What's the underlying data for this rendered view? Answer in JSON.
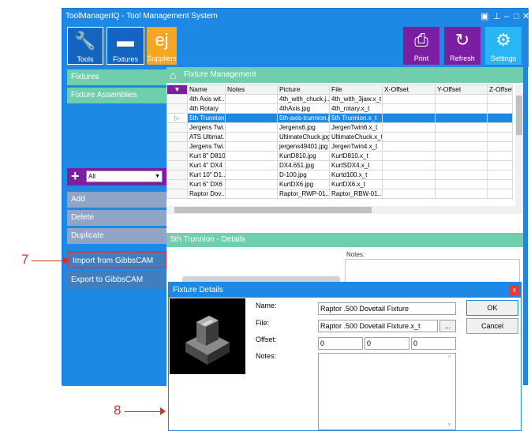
{
  "window": {
    "title": "ToolManagerIQ - Tool Management System"
  },
  "toolbar": {
    "tools_label": "Tools",
    "fixtures_label": "Fixtures",
    "suppliers_label": "Suppliers",
    "print_label": "Print",
    "refresh_label": "Refresh",
    "settings_label": "Settings"
  },
  "sidebar": {
    "fixtures": "Fixtures",
    "assemblies": "Fixture Assemblies",
    "filter_value": "All",
    "add": "Add",
    "delete": "Delete",
    "duplicate": "Duplicate",
    "import": "Import from GibbsCAM",
    "export": "Export to GibbsCAM"
  },
  "main": {
    "header": "Fixture Management",
    "details_header": "5th Trunnion - Details",
    "notes_label": "Notes:"
  },
  "grid": {
    "columns": [
      "Name",
      "Notes",
      "Picture",
      "File",
      "X-Offset",
      "Y-Offset",
      "Z-Offset"
    ],
    "rows": [
      [
        "4th Axis wit...",
        "",
        "4th_with_chuck.j...",
        "4th_with_3jaw.x_t",
        "",
        "",
        ""
      ],
      [
        "4th Rotary",
        "",
        "4thAxis.jpg",
        "4th_rotary.x_t",
        "",
        "",
        ""
      ],
      [
        "5th Trunnion",
        "",
        "5th-axis-trunnion.j...",
        "5th Trunnion.x_t",
        "",
        "",
        ""
      ],
      [
        "Jergens Twi...",
        "",
        "Jergens6.jpg",
        "JergenTwin6.x_t",
        "",
        "",
        ""
      ],
      [
        "ATS Ultimat...",
        "",
        "UltimateChuck.jpg",
        "UltimateChuck.x_t",
        "",
        "",
        ""
      ],
      [
        "Jergens Twi...",
        "",
        "jergens49401.jpg",
        "JergenTwin4.x_t",
        "",
        "",
        ""
      ],
      [
        "Kurt 8\" D810",
        "",
        "KurtD810.jpg",
        "KurtD810.x_t",
        "",
        "",
        ""
      ],
      [
        "Kurt 4\" DX4",
        "",
        "DX4.651.jpg",
        "KurtSDX4.x_t",
        "",
        "",
        ""
      ],
      [
        "Kurt 10\" D1...",
        "",
        "D-100.jpg",
        "Kurtd100.x_t",
        "",
        "",
        ""
      ],
      [
        "Kurt 6\" DX6",
        "",
        "KurtDX6.jpg",
        "KurtDX6.x_t",
        "",
        "",
        ""
      ],
      [
        "Raptor Dov...",
        "",
        "Raptor_RWP-01...",
        "Raptor_RBW-01...",
        "",
        "",
        ""
      ]
    ]
  },
  "dialog": {
    "title": "Fixture Details",
    "name_label": "Name:",
    "name_value": "Raptor .500 Dovetail Fixture",
    "file_label": "File:",
    "file_value": "Raptor .500 Dovetail Fixture.x_t",
    "browse_label": "...",
    "offset_label": "Offset:",
    "offset_x": "0",
    "offset_y": "0",
    "offset_z": "0",
    "notes_label": "Notes:",
    "ok": "OK",
    "cancel": "Cancel",
    "close": "x"
  },
  "callouts": {
    "seven": "7",
    "eight": "8"
  },
  "colors": {
    "accent": "#1e88e5",
    "purple": "#7b1fa2",
    "orange": "#f5a623",
    "teal": "#6fcfad",
    "callout": "#d32f2f"
  }
}
